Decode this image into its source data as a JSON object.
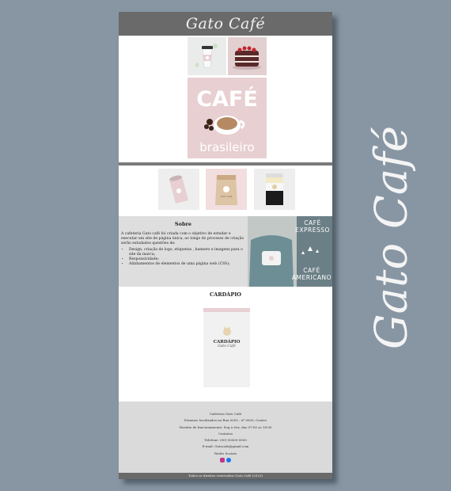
{
  "header": {
    "logo": "Gato Café"
  },
  "hero": {
    "cafe_word": "CAFÉ",
    "brasileiro_word": "brasileiro"
  },
  "packaging": {
    "bag_label": "Gato Café"
  },
  "about": {
    "title": "Sobre",
    "text": "A cafeteria Gato café foi criada com o objetivo de estudar e executar um site de página única, ao longo do processo de criação serão estudados questões de:",
    "bullets": [
      "Design, criação de logo, etiquetas , banners e imagens para o site da marca;",
      "Responsividade;",
      "Alinhamentos de elementos de uma página web (CSS);"
    ]
  },
  "promo": {
    "top": "CAFÉ\nEXPRESSO",
    "bottom": "CAFÉ\nAMERICANO"
  },
  "menu": {
    "title": "CARDÁPIO",
    "card_title": "CARDÁPIO",
    "card_logo": "Gato Café"
  },
  "footer": {
    "lines": [
      "Cafeteria Gato Café",
      "Estamos localizados na Rua 0000 , nº 0000, Centro",
      "Horário de funcionamento: Seg a Sex, das 07:00 as 18:00",
      "Contatos",
      "Telefone: (00) 00000-0000",
      "E-mail: Gatocafe@gmail.com",
      "Redes Sociais"
    ]
  },
  "bottom_bar": "Todos os direitos reservados Gato Café (2023)",
  "side_logo": "Gato Café",
  "colors": {
    "bg": "#8896a4",
    "header": "#6a6a6a",
    "pink": "#e7cfd2",
    "instagram": "#c13584",
    "facebook": "#1877f2"
  }
}
